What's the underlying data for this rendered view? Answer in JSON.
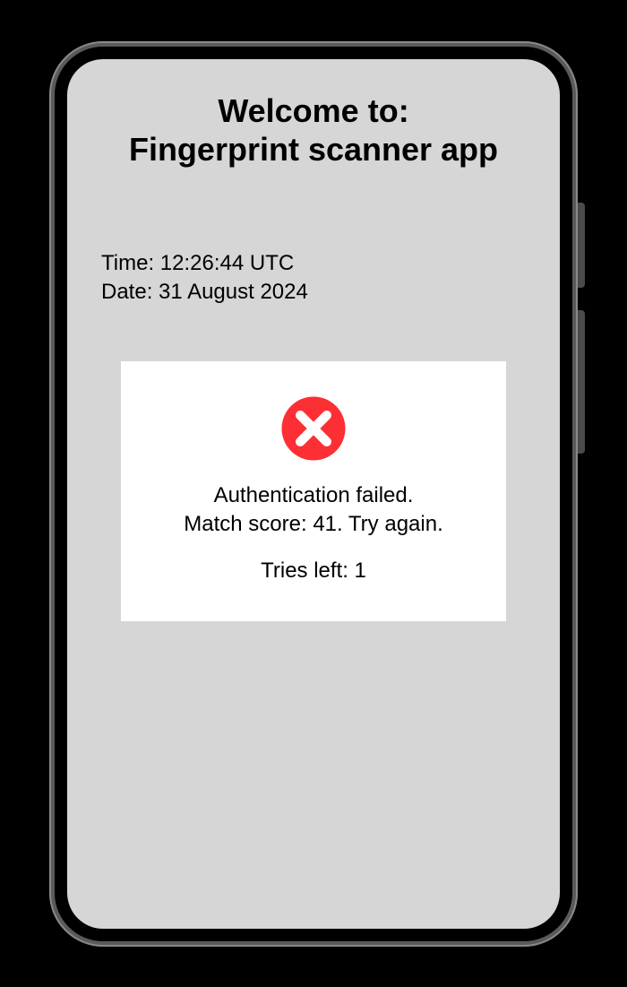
{
  "header": {
    "line1": "Welcome to:",
    "line2": "Fingerprint scanner app"
  },
  "datetime": {
    "time_label": "Time: ",
    "time_value": "12:26:44 UTC",
    "date_label": "Date: ",
    "date_value": "31 August 2024"
  },
  "card": {
    "status_line": "Authentication failed.",
    "score_line": "Match score: 41. Try again.",
    "tries_line": "Tries left: 1",
    "icon_color": "#fc2f35"
  }
}
